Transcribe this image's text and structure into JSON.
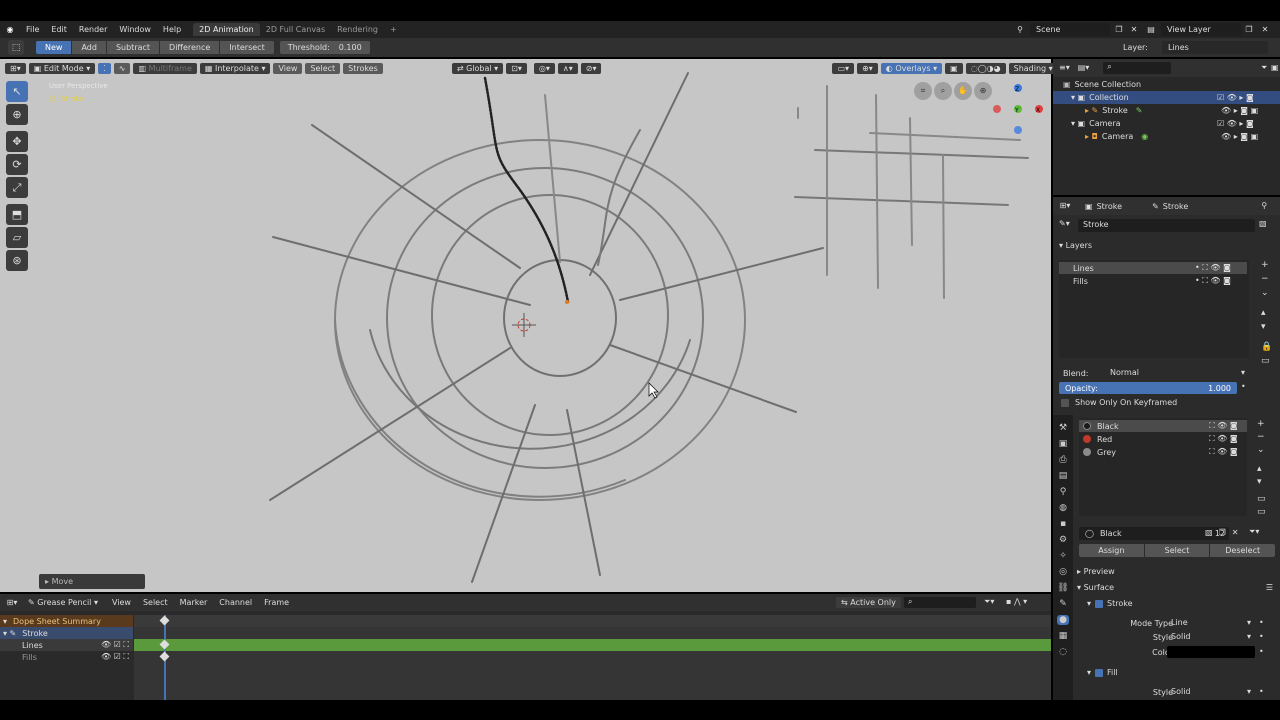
{
  "topbar": {
    "menus": [
      "File",
      "Edit",
      "Render",
      "Window",
      "Help"
    ],
    "workspaces": [
      "2D Animation",
      "2D Full Canvas",
      "Rendering"
    ],
    "add_tab": "+",
    "scene": "Scene",
    "view_layer": "View Layer"
  },
  "tool_options": {
    "buttons": [
      "New",
      "Add",
      "Subtract",
      "Difference",
      "Intersect"
    ],
    "threshold_label": "Threshold:",
    "threshold_value": "0.100",
    "layer_label": "Layer:",
    "layer_value": "Lines"
  },
  "viewport_header": {
    "mode": "Edit Mode",
    "multiframe": "Multiframe",
    "interpolate": "Interpolate",
    "menus": [
      "View",
      "Select",
      "Strokes"
    ],
    "orientation": "Global",
    "overlays": "Overlays",
    "shading": "Shading"
  },
  "viewport": {
    "perspective": "User Perspective",
    "object": "(1) Stroke",
    "last_op": "Move"
  },
  "outliner": {
    "rows": [
      "Scene Collection",
      "Collection",
      "Stroke",
      "Camera",
      "Camera"
    ]
  },
  "properties": {
    "header_object": "Stroke",
    "header_data": "Stroke",
    "data_name": "Stroke",
    "layers_title": "Layers",
    "layers": [
      "Lines",
      "Fills"
    ],
    "blend_label": "Blend:",
    "blend_value": "Normal",
    "opacity_label": "Opacity:",
    "opacity_value": "1.000",
    "opacity_fraction": 1.0,
    "show_keyframed": "Show Only On Keyframed",
    "materials": [
      "Black",
      "Red",
      "Grey"
    ],
    "material_colors": [
      "#1a1a1a",
      "#c0392b",
      "#8a8a8a"
    ],
    "material_name": "Black",
    "material_users": "12",
    "assign": "Assign",
    "select": "Select",
    "deselect": "Deselect",
    "preview": "Preview",
    "surface": "Surface",
    "stroke_section": "Stroke",
    "mode_type_label": "Mode Type",
    "mode_type_value": "Line",
    "style_label": "Style",
    "style_value": "Solid",
    "color_label": "Color",
    "fill_section": "Fill",
    "fill_style_label": "Style",
    "fill_style_value": "Solid"
  },
  "timeline": {
    "editor": "Grease Pencil",
    "menus": [
      "View",
      "Select",
      "Marker",
      "Channel",
      "Frame"
    ],
    "active_only": "Active Only",
    "channels": [
      "Dope Sheet Summary",
      "Stroke",
      "Lines",
      "Fills"
    ]
  },
  "colors": {
    "accent": "#4772b3",
    "keyframe_track": "#5a9a3c",
    "summary": "#c27d1e"
  }
}
